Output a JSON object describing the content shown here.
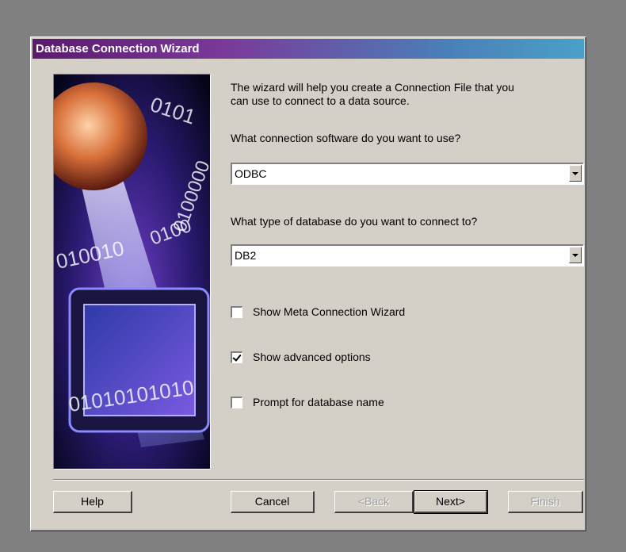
{
  "window": {
    "title": "Database Connection Wizard"
  },
  "intro_text": "The wizard will help you create a Connection File that you\ncan use to connect to a data source.",
  "connection_software": {
    "question": "What connection software do you want to use?",
    "value": "ODBC"
  },
  "database_type": {
    "question": "What type of database do you want to connect to?",
    "value": "DB2"
  },
  "options": [
    {
      "label": "Show Meta Connection Wizard",
      "checked": false
    },
    {
      "label": "Show advanced options",
      "checked": true
    },
    {
      "label": "Prompt for database name",
      "checked": false
    }
  ],
  "buttons": {
    "help": "Help",
    "cancel": "Cancel",
    "back": "<Back",
    "next": "Next>",
    "finish": "Finish"
  },
  "art_text": {
    "binary_top": "0101",
    "binary_right": "0100000",
    "binary_mid": "010010",
    "binary_mid2": "0100",
    "binary_bottom": "01010101010"
  },
  "colors": {
    "dialog_bg": "#d4d0c8",
    "title_start": "#5b1a6e",
    "title_end": "#4aa0c8",
    "desktop": "#808080"
  }
}
